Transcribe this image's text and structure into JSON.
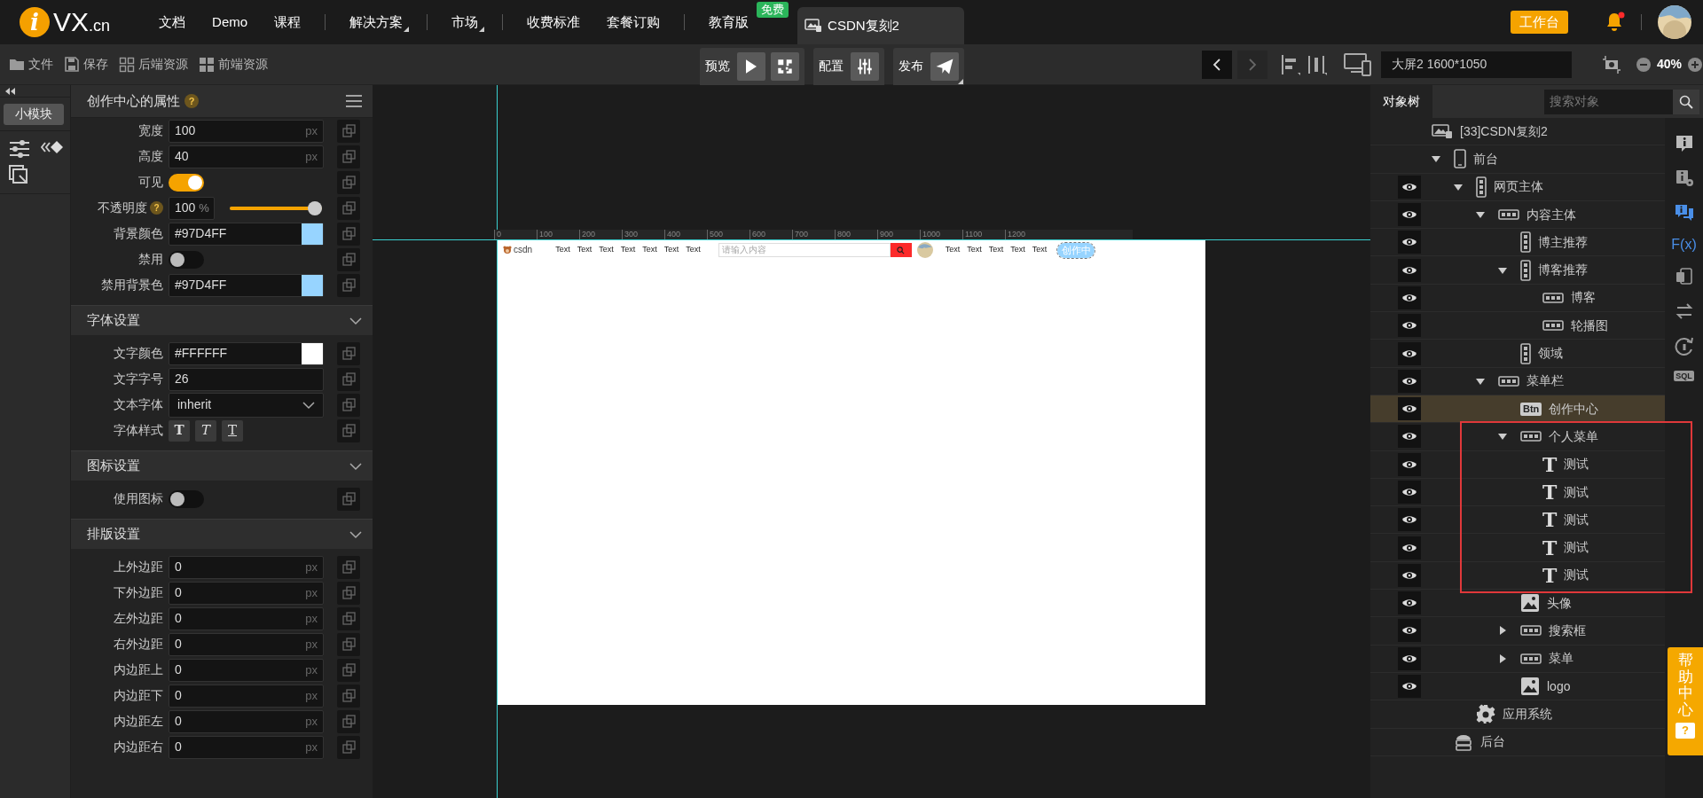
{
  "top_bar": {
    "logo": {
      "mark": "i",
      "name": "VX",
      "suffix": ".cn"
    },
    "nav_groups": [
      [
        {
          "label": "文档",
          "dropdown": false
        },
        {
          "label": "Demo",
          "dropdown": false
        },
        {
          "label": "课程",
          "dropdown": false
        }
      ],
      [
        {
          "label": "解决方案",
          "dropdown": true
        }
      ],
      [
        {
          "label": "市场",
          "dropdown": true
        }
      ],
      [
        {
          "label": "收费标准",
          "dropdown": false
        },
        {
          "label": "套餐订购",
          "dropdown": false
        }
      ],
      [
        {
          "label": "教育版",
          "dropdown": false,
          "badge": "免费"
        }
      ]
    ],
    "project_tab": {
      "label": "CSDN复刻2"
    },
    "workbench_button": "工作台",
    "notifications": {
      "unread": true
    }
  },
  "toolbar": {
    "file_actions": [
      {
        "kind": "folder",
        "label": "文件"
      },
      {
        "kind": "save",
        "label": "保存"
      },
      {
        "kind": "grid",
        "label": "后端资源"
      },
      {
        "kind": "tiles",
        "label": "前端资源"
      }
    ],
    "groups": [
      {
        "kind": "preview",
        "label": "预览"
      },
      {
        "kind": "config",
        "label": "配置"
      },
      {
        "kind": "publish",
        "label": "发布"
      }
    ],
    "screen_size": "大屏2 1600*1050",
    "zoom": "40%"
  },
  "left_rail": {
    "module_button": "小模块"
  },
  "properties": {
    "title": "创作中心的属性",
    "title_hint": "?",
    "sections": [
      {
        "rows": [
          {
            "kind": "input",
            "label": "宽度",
            "value": "100",
            "unit": "px"
          },
          {
            "kind": "input",
            "label": "高度",
            "value": "40",
            "unit": "px"
          },
          {
            "kind": "toggle",
            "label": "可见",
            "on": true
          },
          {
            "kind": "slider",
            "label": "不透明度",
            "hint": "?",
            "value": "100",
            "unit": "%",
            "level": 1
          },
          {
            "kind": "color",
            "label": "背景颜色",
            "value": "#97D4FF"
          },
          {
            "kind": "toggle",
            "label": "禁用",
            "on": false
          },
          {
            "kind": "color",
            "label": "禁用背景色",
            "value": "#97D4FF"
          }
        ]
      },
      {
        "title": "字体设置",
        "expanded": true,
        "rows": [
          {
            "kind": "color",
            "label": "文字颜色",
            "value": "#FFFFFF"
          },
          {
            "kind": "input",
            "label": "文字字号",
            "value": "26"
          },
          {
            "kind": "select",
            "label": "文本字体",
            "value": "inherit"
          },
          {
            "kind": "font_style",
            "label": "字体样式",
            "buttons": [
              {
                "kind": "bold",
                "glyph": "T"
              },
              {
                "kind": "italic",
                "glyph": "T"
              },
              {
                "kind": "underline",
                "glyph": "T"
              }
            ]
          }
        ]
      },
      {
        "title": "图标设置",
        "expanded": true,
        "rows": [
          {
            "kind": "toggle",
            "label": "使用图标",
            "on": false
          }
        ]
      },
      {
        "title": "排版设置",
        "expanded": true,
        "rows": [
          {
            "kind": "input",
            "label": "上外边距",
            "value": "0",
            "unit": "px"
          },
          {
            "kind": "input",
            "label": "下外边距",
            "value": "0",
            "unit": "px"
          },
          {
            "kind": "input",
            "label": "左外边距",
            "value": "0",
            "unit": "px"
          },
          {
            "kind": "input",
            "label": "右外边距",
            "value": "0",
            "unit": "px"
          },
          {
            "kind": "input",
            "label": "内边距上",
            "value": "0",
            "unit": "px"
          },
          {
            "kind": "input",
            "label": "内边距下",
            "value": "0",
            "unit": "px"
          },
          {
            "kind": "input",
            "label": "内边距左",
            "value": "0",
            "unit": "px"
          },
          {
            "kind": "input",
            "label": "内边距右",
            "value": "0",
            "unit": "px"
          }
        ]
      }
    ]
  },
  "canvas": {
    "ruler": [
      "0",
      "100",
      "200",
      "300",
      "400",
      "500",
      "600",
      "700",
      "800",
      "900",
      "1000",
      "1100",
      "1200"
    ],
    "page": {
      "logo": "csdn",
      "menu": [
        "Text",
        "Text",
        "Text",
        "Text",
        "Text",
        "Text",
        "Text"
      ],
      "search_placeholder": "请输入内容",
      "user_menu": [
        "Text",
        "Text",
        "Text",
        "Text",
        "Text"
      ],
      "create_button": "创作中"
    }
  },
  "object_tree": {
    "tab": "对象树",
    "search_placeholder": "搜索对象",
    "root": {
      "label": "[33]CSDN复刻2",
      "kind": "app",
      "selected": false,
      "children": [
        {
          "label": "前台",
          "kind": "device",
          "expanded": true,
          "eye": false,
          "selected": false,
          "children": [
            {
              "label": "网页主体",
              "kind": "vbox",
              "expanded": true,
              "eye": true,
              "selected": false,
              "children": [
                {
                  "label": "内容主体",
                  "kind": "hbox",
                  "expanded": true,
                  "eye": true,
                  "selected": false,
                  "children": [
                    {
                      "label": "博主推荐",
                      "kind": "vbox",
                      "eye": true,
                      "selected": false
                    },
                    {
                      "label": "博客推荐",
                      "kind": "vbox",
                      "expanded": true,
                      "eye": true,
                      "selected": false,
                      "children": [
                        {
                          "label": "博客",
                          "kind": "hbox",
                          "eye": true,
                          "selected": false
                        },
                        {
                          "label": "轮播图",
                          "kind": "hbox",
                          "eye": true,
                          "selected": false
                        }
                      ]
                    },
                    {
                      "label": "领域",
                      "kind": "vbox",
                      "eye": true,
                      "selected": false
                    }
                  ]
                },
                {
                  "label": "菜单栏",
                  "kind": "hbox",
                  "expanded": true,
                  "eye": true,
                  "selected": false,
                  "children": [
                    {
                      "label": "创作中心",
                      "kind": "button",
                      "badge": "Btn",
                      "eye": true,
                      "selected": true
                    },
                    {
                      "label": "个人菜单",
                      "kind": "hbox",
                      "expanded": true,
                      "eye": true,
                      "selected": false,
                      "outlined": true,
                      "children": [
                        {
                          "label": "测试",
                          "kind": "text",
                          "glyph": "T",
                          "eye": true,
                          "selected": false
                        },
                        {
                          "label": "测试",
                          "kind": "text",
                          "glyph": "T",
                          "eye": true,
                          "selected": false
                        },
                        {
                          "label": "测试",
                          "kind": "text",
                          "glyph": "T",
                          "eye": true,
                          "selected": false
                        },
                        {
                          "label": "测试",
                          "kind": "text",
                          "glyph": "T",
                          "eye": true,
                          "selected": false
                        },
                        {
                          "label": "测试",
                          "kind": "text",
                          "glyph": "T",
                          "eye": true,
                          "selected": false
                        }
                      ]
                    },
                    {
                      "label": "头像",
                      "kind": "image",
                      "eye": true,
                      "selected": false
                    },
                    {
                      "label": "搜索框",
                      "kind": "hbox",
                      "expanded": false,
                      "eye": true,
                      "selected": false
                    },
                    {
                      "label": "菜单",
                      "kind": "hbox",
                      "expanded": false,
                      "eye": true,
                      "selected": false
                    },
                    {
                      "label": "logo",
                      "kind": "image",
                      "eye": true,
                      "selected": false
                    }
                  ]
                }
              ]
            },
            {
              "label": "应用系统",
              "kind": "gear",
              "eye": false,
              "selected": false
            }
          ]
        },
        {
          "label": "后台",
          "kind": "server",
          "eye": false,
          "selected": false
        }
      ]
    }
  },
  "side_tools": [
    {
      "kind": "info",
      "selected": false
    },
    {
      "kind": "info_settings",
      "selected": false
    },
    {
      "kind": "comments",
      "selected": true
    },
    {
      "kind": "function",
      "glyph": "F(x)",
      "selected": false
    },
    {
      "kind": "copy",
      "selected": false
    },
    {
      "kind": "swap",
      "selected": false
    },
    {
      "kind": "refresh",
      "selected": false
    },
    {
      "kind": "sql",
      "glyph": "SQL",
      "selected": false
    }
  ],
  "help_center": {
    "label": "帮助中心",
    "mark": "?"
  }
}
